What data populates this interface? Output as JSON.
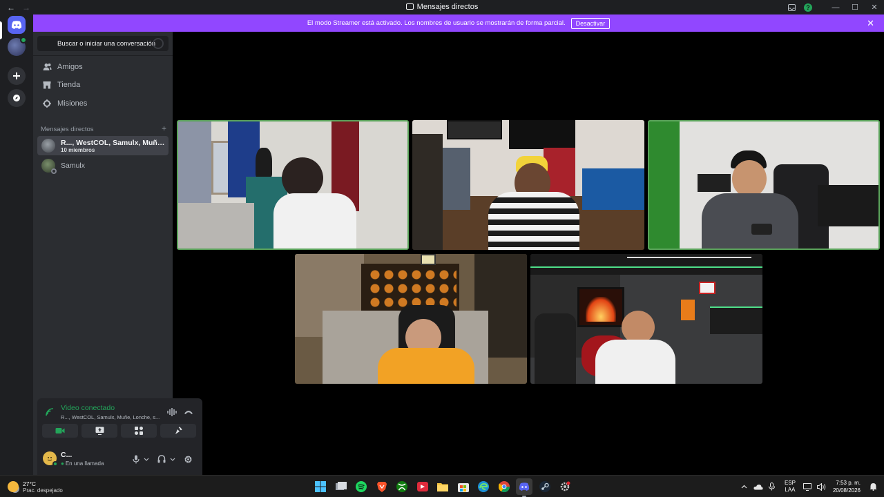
{
  "window": {
    "title": "Mensajes directos",
    "back": "←",
    "forward": "→",
    "minimize": "—",
    "maximize": "☐",
    "close": "✕"
  },
  "banner": {
    "text": "El modo Streamer está activado. Los nombres de usuario se mostrarán de forma parcial.",
    "button": "Desactivar",
    "close": "✕"
  },
  "sidebar": {
    "search_placeholder": "Buscar o iniciar una conversación",
    "nav": [
      {
        "label": "Amigos",
        "icon": "friends-icon"
      },
      {
        "label": "Tienda",
        "icon": "store-icon"
      },
      {
        "label": "Misiones",
        "icon": "quests-icon"
      }
    ],
    "dm_header": "Mensajes directos",
    "dm_add": "+",
    "dms": [
      {
        "name": "R..., WestCOL, Samulx, Muñe, L...",
        "sub": "10 miembros",
        "active": true
      },
      {
        "name": "Samulx",
        "sub": "",
        "active": false
      }
    ]
  },
  "voice": {
    "status": "Video conectado",
    "channel": "R..., WestCOL, Samulx, Muñe, Lonche, s...",
    "user_name": "C...",
    "user_status": "En una llamada"
  },
  "taskbar": {
    "temp": "27°C",
    "weather": "Prac. despejado",
    "lang_top": "ESP",
    "lang_bottom": "LAA",
    "time": "7:53 p. m.",
    "date": "20/08/2026",
    "apps": [
      "windows-start-icon",
      "file-explorer-icon",
      "spotify-icon",
      "brave-icon",
      "xbox-icon",
      "app-red-icon",
      "folder-icon",
      "store-icon",
      "edge-icon",
      "chrome-icon",
      "discord-icon",
      "steam-icon",
      "settings-icon"
    ]
  },
  "colors": {
    "accent": "#5865f2",
    "streamer_banner": "#9147ff",
    "connected": "#23a55a",
    "speaking_border": "#5ba35b"
  }
}
